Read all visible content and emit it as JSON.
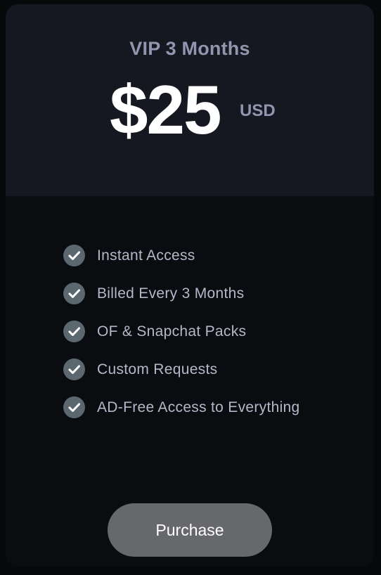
{
  "plan": {
    "name": "VIP 3 Months",
    "price": "$25",
    "currency": "USD"
  },
  "features": [
    {
      "label": "Instant Access",
      "icon": "check-circle-icon"
    },
    {
      "label": "Billed Every 3 Months",
      "icon": "check-circle-icon"
    },
    {
      "label": "OF & Snapchat Packs",
      "icon": "check-circle-icon"
    },
    {
      "label": "Custom Requests",
      "icon": "check-circle-icon"
    },
    {
      "label": "AD-Free Access to Everything",
      "icon": "check-circle-icon"
    }
  ],
  "purchase_button": {
    "label": "Purchase"
  },
  "colors": {
    "header_bg": "#151820",
    "body_bg": "#0b0c10",
    "accent_text": "#8f96ad",
    "check_bg": "#5b6870",
    "button_bg": "#67686c"
  }
}
